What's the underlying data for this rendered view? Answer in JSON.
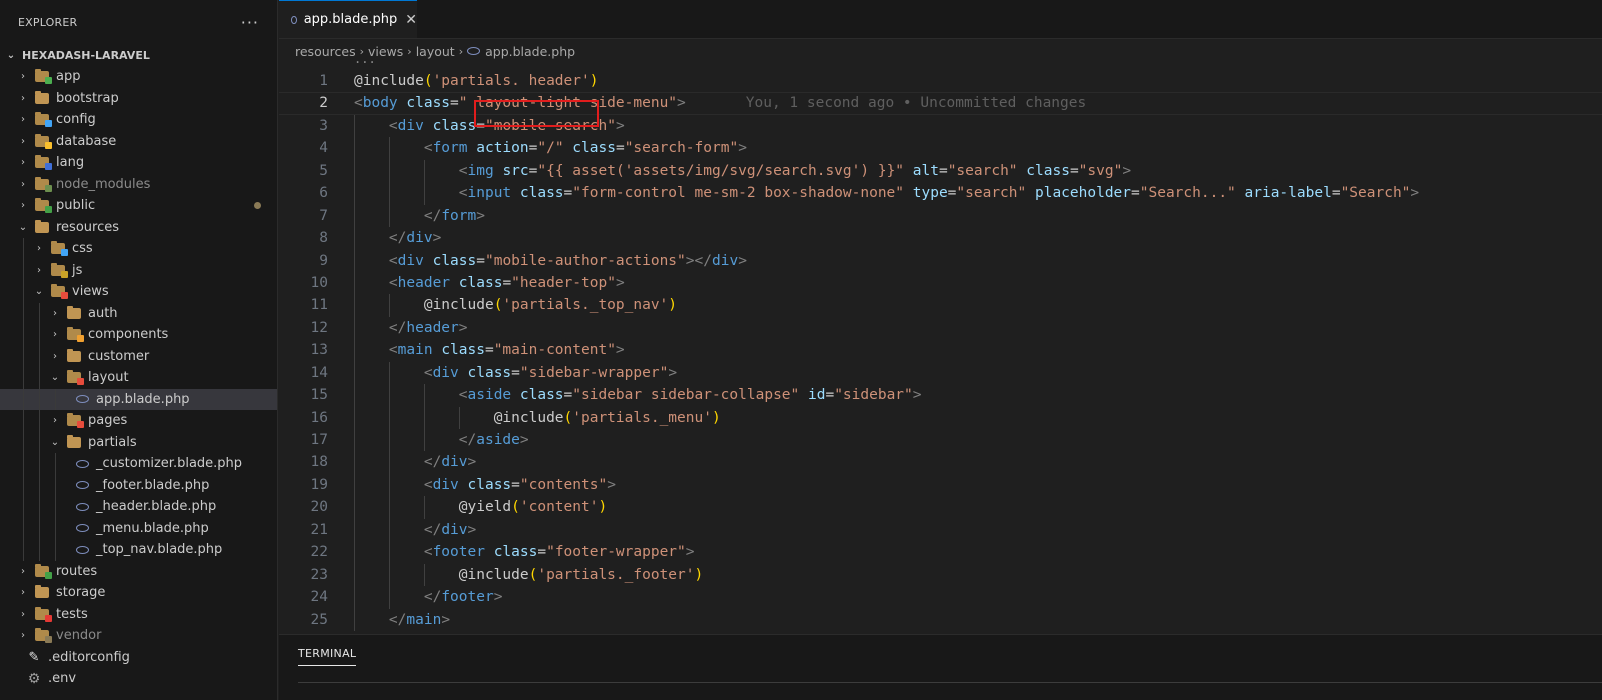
{
  "explorer": {
    "title": "EXPLORER",
    "more": "···",
    "project": "HEXADASH-LARAVEL",
    "items": [
      {
        "label": "app",
        "twisty": "›",
        "icon": "folder-app-icon",
        "color": "#4caf50",
        "depth": 0
      },
      {
        "label": "bootstrap",
        "twisty": "›",
        "icon": "folder-icon",
        "color": "#c09553",
        "depth": 0
      },
      {
        "label": "config",
        "twisty": "›",
        "icon": "folder-config-icon",
        "color": "#42a5f5",
        "depth": 0
      },
      {
        "label": "database",
        "twisty": "›",
        "icon": "folder-database-icon",
        "color": "#fbc02d",
        "depth": 0
      },
      {
        "label": "lang",
        "twisty": "›",
        "icon": "folder-lang-icon",
        "color": "#3f6fd8",
        "depth": 0
      },
      {
        "label": "node_modules",
        "twisty": "›",
        "icon": "folder-node-icon",
        "color": "#6d8f4f",
        "depth": 0
      },
      {
        "label": "public",
        "twisty": "›",
        "icon": "folder-public-icon",
        "color": "#43a047",
        "depth": 0
      },
      {
        "label": "resources",
        "twisty": "⌄",
        "icon": "folder-open-icon",
        "color": "#c09553",
        "depth": 0
      },
      {
        "label": "css",
        "twisty": "›",
        "icon": "folder-css-icon",
        "color": "#42a5f5",
        "depth": 1
      },
      {
        "label": "js",
        "twisty": "›",
        "icon": "folder-js-icon",
        "color": "#c9a227",
        "depth": 1
      },
      {
        "label": "views",
        "twisty": "⌄",
        "icon": "folder-views-icon",
        "color": "#e74c3c",
        "depth": 1
      },
      {
        "label": "auth",
        "twisty": "›",
        "icon": "folder-icon",
        "color": "#c09553",
        "depth": 2
      },
      {
        "label": "components",
        "twisty": "›",
        "icon": "folder-components-icon",
        "color": "#f0a030",
        "depth": 2
      },
      {
        "label": "customer",
        "twisty": "›",
        "icon": "folder-icon",
        "color": "#c09553",
        "depth": 2
      },
      {
        "label": "layout",
        "twisty": "⌄",
        "icon": "folder-layout-icon",
        "color": "#e74c3c",
        "depth": 2
      },
      {
        "label": "app.blade.php",
        "twisty": "",
        "icon": "blade-file-icon",
        "color": "#7f8fbf",
        "depth": 3
      },
      {
        "label": "pages",
        "twisty": "›",
        "icon": "folder-pages-icon",
        "color": "#e74c3c",
        "depth": 2
      },
      {
        "label": "partials",
        "twisty": "⌄",
        "icon": "folder-open-icon",
        "color": "#c09553",
        "depth": 2
      },
      {
        "label": "_customizer.blade.php",
        "twisty": "",
        "icon": "blade-file-icon",
        "color": "#7f8fbf",
        "depth": 3
      },
      {
        "label": "_footer.blade.php",
        "twisty": "",
        "icon": "blade-file-icon",
        "color": "#7f8fbf",
        "depth": 3
      },
      {
        "label": "_header.blade.php",
        "twisty": "",
        "icon": "blade-file-icon",
        "color": "#7f8fbf",
        "depth": 3
      },
      {
        "label": "_menu.blade.php",
        "twisty": "",
        "icon": "blade-file-icon",
        "color": "#7f8fbf",
        "depth": 3
      },
      {
        "label": "_top_nav.blade.php",
        "twisty": "",
        "icon": "blade-file-icon",
        "color": "#7f8fbf",
        "depth": 3
      },
      {
        "label": "routes",
        "twisty": "›",
        "icon": "folder-routes-icon",
        "color": "#43a047",
        "depth": 0
      },
      {
        "label": "storage",
        "twisty": "›",
        "icon": "folder-icon",
        "color": "#c09553",
        "depth": 0
      },
      {
        "label": "tests",
        "twisty": "›",
        "icon": "folder-tests-icon",
        "color": "#e53935",
        "depth": 0
      },
      {
        "label": "vendor",
        "twisty": "›",
        "icon": "folder-vendor-icon",
        "color": "#8a7a56",
        "depth": 0
      },
      {
        "label": ".editorconfig",
        "twisty": "",
        "icon": "editorconfig-file-icon",
        "color": "#e0e0e0",
        "depth": 0
      },
      {
        "label": ".env",
        "twisty": "",
        "icon": "gear-file-icon",
        "color": "#9e9e9e",
        "depth": 0
      }
    ]
  },
  "tab": {
    "label": "app.blade.php",
    "close": "✕"
  },
  "breadcrumbs": [
    "resources",
    "views",
    "layout",
    "app.blade.php"
  ],
  "editor": {
    "fold_marker": "...",
    "current_line": 2,
    "blame": "You, 1 second ago • Uncommitted changes",
    "lines": [
      {
        "n": "1",
        "code": "@include('partials. header')"
      },
      {
        "n": "2",
        "code": "<body class=\" layout-light side-menu\">"
      },
      {
        "n": "3",
        "code": "    <div class=\"mobile-search\">"
      },
      {
        "n": "4",
        "code": "        <form action=\"/\" class=\"search-form\">"
      },
      {
        "n": "5",
        "code": "            <img src=\"{{ asset('assets/img/svg/search.svg') }}\" alt=\"search\" class=\"svg\">"
      },
      {
        "n": "6",
        "code": "            <input class=\"form-control me-sm-2 box-shadow-none\" type=\"search\" placeholder=\"Search...\" aria-label=\"Search\">"
      },
      {
        "n": "7",
        "code": "        </form>"
      },
      {
        "n": "8",
        "code": "    </div>"
      },
      {
        "n": "9",
        "code": "    <div class=\"mobile-author-actions\"></div>"
      },
      {
        "n": "10",
        "code": "    <header class=\"header-top\">"
      },
      {
        "n": "11",
        "code": "        @include('partials._top_nav')"
      },
      {
        "n": "12",
        "code": "    </header>"
      },
      {
        "n": "13",
        "code": "    <main class=\"main-content\">"
      },
      {
        "n": "14",
        "code": "        <div class=\"sidebar-wrapper\">"
      },
      {
        "n": "15",
        "code": "            <aside class=\"sidebar sidebar-collapse\" id=\"sidebar\">"
      },
      {
        "n": "16",
        "code": "                @include('partials._menu')"
      },
      {
        "n": "17",
        "code": "            </aside>"
      },
      {
        "n": "18",
        "code": "        </div>"
      },
      {
        "n": "19",
        "code": "        <div class=\"contents\">"
      },
      {
        "n": "20",
        "code": "            @yield('content')"
      },
      {
        "n": "21",
        "code": "        </div>"
      },
      {
        "n": "22",
        "code": "        <footer class=\"footer-wrapper\">"
      },
      {
        "n": "23",
        "code": "            @include('partials._footer')"
      },
      {
        "n": "24",
        "code": "        </footer>"
      },
      {
        "n": "25",
        "code": "    </main>"
      }
    ]
  },
  "panel": {
    "tab": "TERMINAL"
  },
  "colors": {
    "accent": "#0078d4",
    "highlight_box": "#e11d1d"
  }
}
